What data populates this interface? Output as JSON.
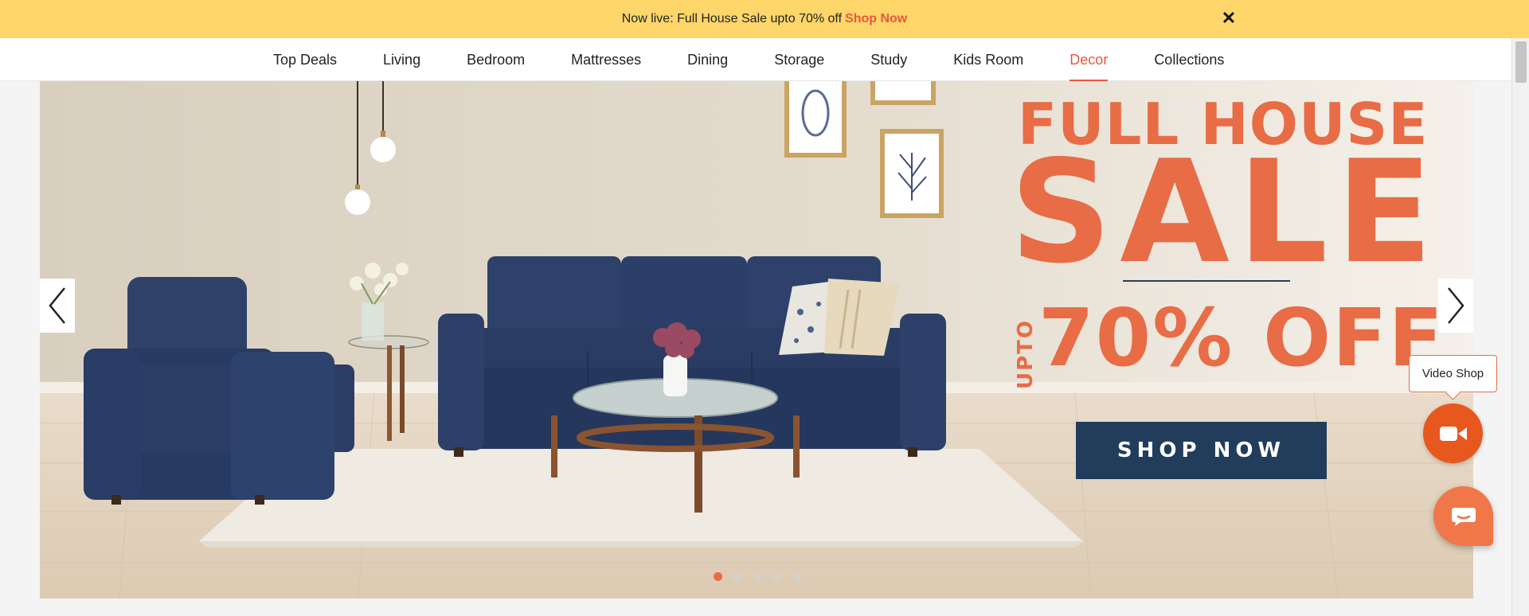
{
  "promo": {
    "text": "Now live: Full House Sale upto 70% off",
    "cta": "Shop Now",
    "close_icon": "close-icon"
  },
  "nav": {
    "items": [
      {
        "label": "Top Deals"
      },
      {
        "label": "Living"
      },
      {
        "label": "Bedroom"
      },
      {
        "label": "Mattresses"
      },
      {
        "label": "Dining"
      },
      {
        "label": "Storage"
      },
      {
        "label": "Study"
      },
      {
        "label": "Kids Room"
      },
      {
        "label": "Decor",
        "active": true
      },
      {
        "label": "Collections"
      }
    ]
  },
  "hero": {
    "headline_1": "FULL HOUSE",
    "headline_2": "SALE",
    "upto": "UPTO",
    "discount": "70% OFF",
    "cta": "SHOP NOW",
    "slides_total": 5,
    "active_slide": 1
  },
  "widgets": {
    "video_label": "Video Shop",
    "video_icon": "video-camera-icon",
    "chat_icon": "chat-icon"
  },
  "colors": {
    "promo_bg": "#ffd66a",
    "accent": "#e8573b",
    "sale_text": "#e86c45",
    "cta_bg": "#213d5b",
    "sofa": "#2c3e63"
  }
}
